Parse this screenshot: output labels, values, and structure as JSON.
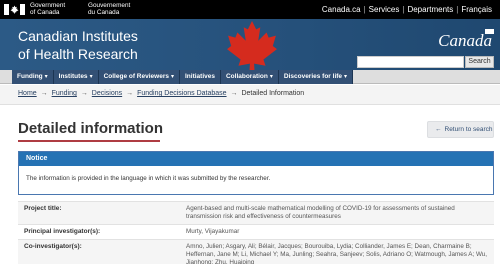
{
  "fip": {
    "gov_en_1": "Government",
    "gov_en_2": "of Canada",
    "gov_fr_1": "Gouvernement",
    "gov_fr_2": "du Canada",
    "links": [
      "Canada.ca",
      "Services",
      "Departments",
      "Français"
    ]
  },
  "banner": {
    "title_line1": "Canadian Institutes",
    "title_line2": "of Health Research",
    "wordmark": "Canada",
    "search_placeholder": "",
    "search_button": "Search"
  },
  "menu": {
    "items": [
      {
        "label": "Funding",
        "chevron": "▾"
      },
      {
        "label": "Institutes",
        "chevron": "▾"
      },
      {
        "label": "College of Reviewers",
        "chevron": "▾"
      },
      {
        "label": "Initiatives",
        "chevron": ""
      },
      {
        "label": "Collaboration",
        "chevron": "▾"
      },
      {
        "label": "Discoveries for life",
        "chevron": "▾"
      }
    ]
  },
  "breadcrumb": {
    "items": [
      "Home",
      "Funding",
      "Decisions",
      "Funding Decisions Database"
    ],
    "current": "Detailed Information",
    "arrow": "→"
  },
  "page": {
    "title": "Detailed information",
    "return_label": "Return to search",
    "return_icon": "←"
  },
  "notice": {
    "heading": "Notice",
    "text": "The information is provided in the language in which it was submitted by the researcher."
  },
  "details": {
    "rows": [
      {
        "label": "Project title:",
        "value": "Agent-based and multi-scale mathematical modelling of COVID-19 for assessments of sustained transmission risk and effectiveness of countermeasures"
      },
      {
        "label": "Principal investigator(s):",
        "value": "Murty, Vijayakumar"
      },
      {
        "label": "Co-investigator(s):",
        "value": "Amno, Julien; Asgary, Ali; Bélair, Jacques; Bourouiba, Lydia; Colliander, James E; Dean, Charmaine B; Heffernan, Jane M; Li, Michael Y; Ma, Junling; Seahra, Sanjeev; Solis, Adriano O; Watmough, James A; Wu, Jianhong; Zhu, Huaiping"
      }
    ]
  },
  "colors": {
    "fip_bar": "#000000",
    "banner": "#25507a",
    "menu_item": "#335075",
    "notice_head": "#2572b4",
    "title_rule": "#af3c43",
    "leaf": "#d52b1e"
  }
}
